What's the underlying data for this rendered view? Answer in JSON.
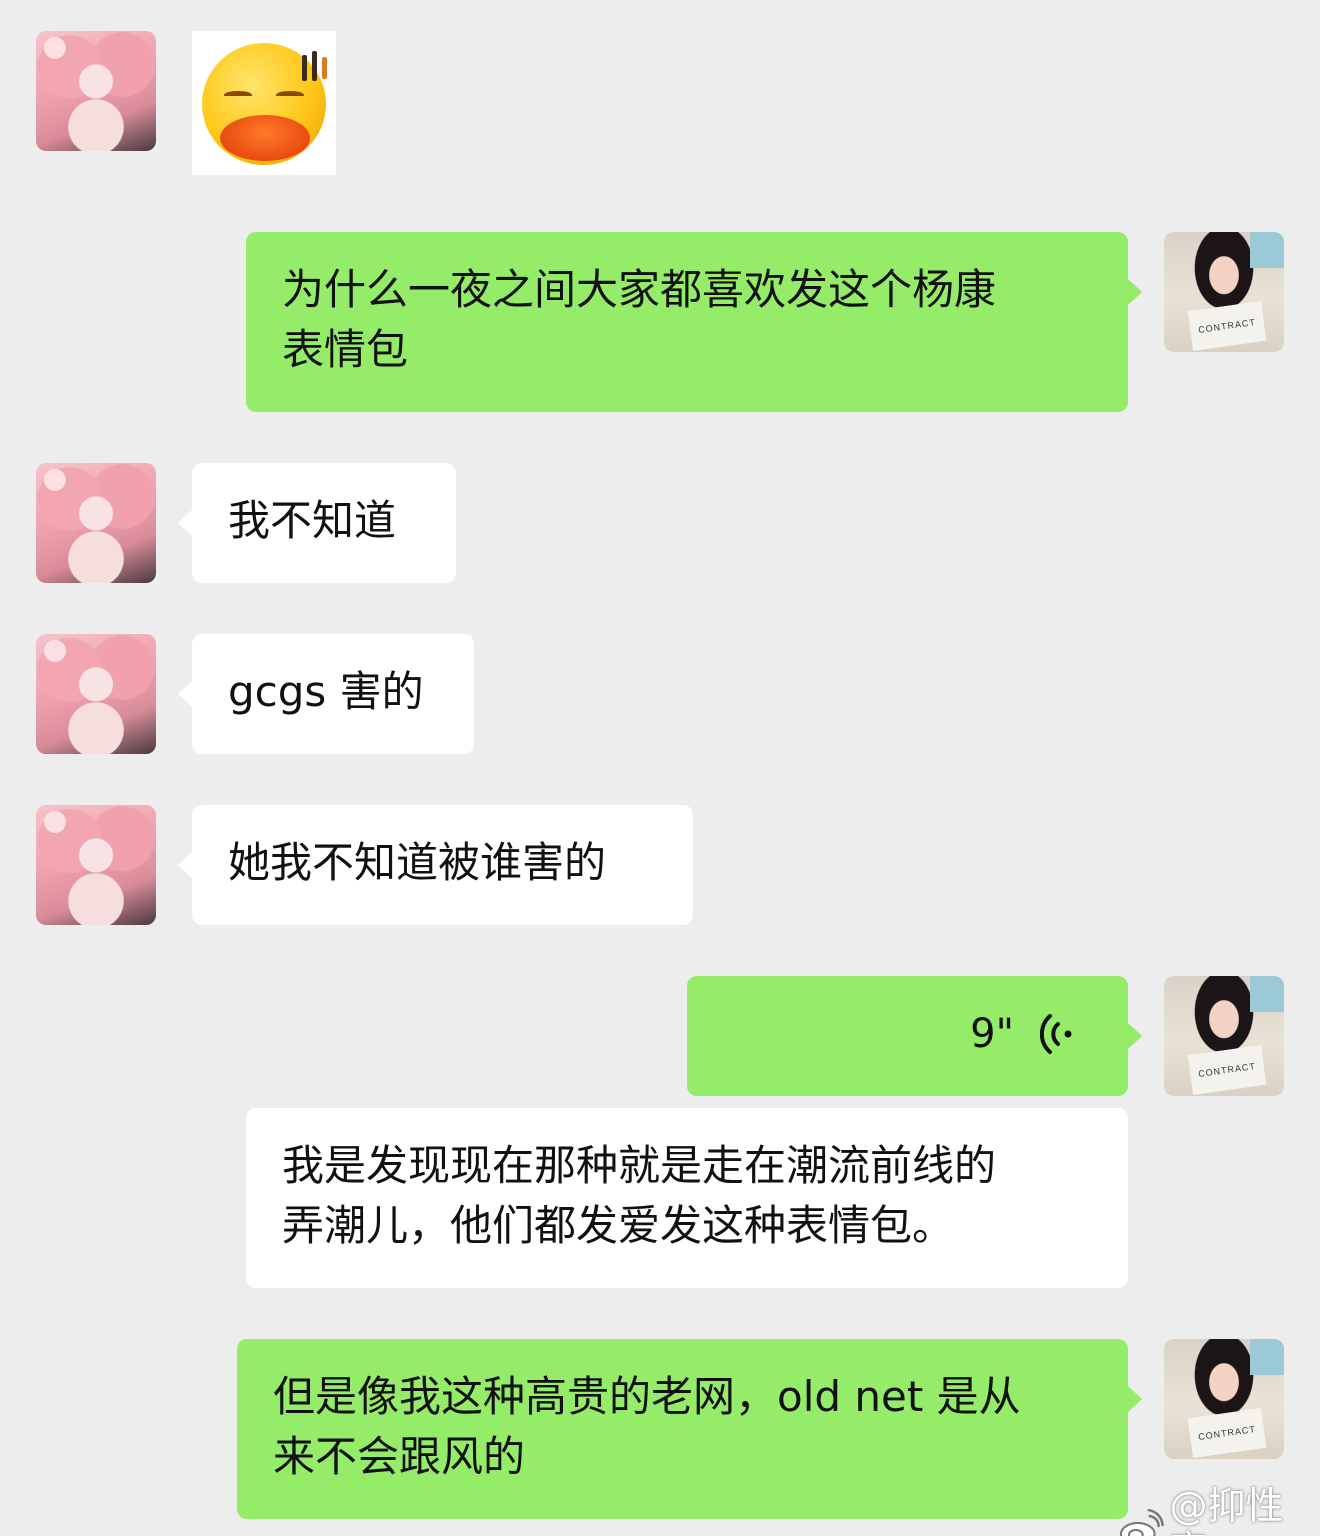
{
  "chat": {
    "messages": [
      {
        "id": "m1",
        "side": "left",
        "type": "sticker",
        "sticker": "yellow-duck-face-sticker"
      },
      {
        "id": "m2",
        "side": "right",
        "type": "text",
        "lines": [
          "为什么一夜之间大家都喜欢发这个杨康",
          "表情包"
        ]
      },
      {
        "id": "m3",
        "side": "left",
        "type": "text",
        "lines": [
          "我不知道"
        ]
      },
      {
        "id": "m4",
        "side": "left",
        "type": "text",
        "lines": [
          "gcgs 害的"
        ]
      },
      {
        "id": "m5",
        "side": "left",
        "type": "text",
        "lines": [
          "她我不知道被谁害的"
        ]
      },
      {
        "id": "m6",
        "side": "right",
        "type": "voice",
        "duration": "9\""
      },
      {
        "id": "m7",
        "side": "right",
        "type": "transcript",
        "lines": [
          "我是发现现在那种就是走在潮流前线的",
          "弄潮儿，他们都发爱发这种表情包。"
        ]
      },
      {
        "id": "m8",
        "side": "right",
        "type": "text",
        "lines": [
          "但是像我这种高贵的老网，old net 是从",
          "来不会跟风的"
        ]
      }
    ]
  },
  "avatars": {
    "left": "pink-hair-anime-girl-avatar",
    "right": "woman-holding-card-avatar",
    "right_card_text": "CONTRACT LAW"
  },
  "watermark": {
    "text": "@抑性恋",
    "icon": "weibo-logo-icon"
  },
  "colors": {
    "background": "#ededed",
    "bubble_self": "#95ec69",
    "bubble_other": "#ffffff"
  }
}
